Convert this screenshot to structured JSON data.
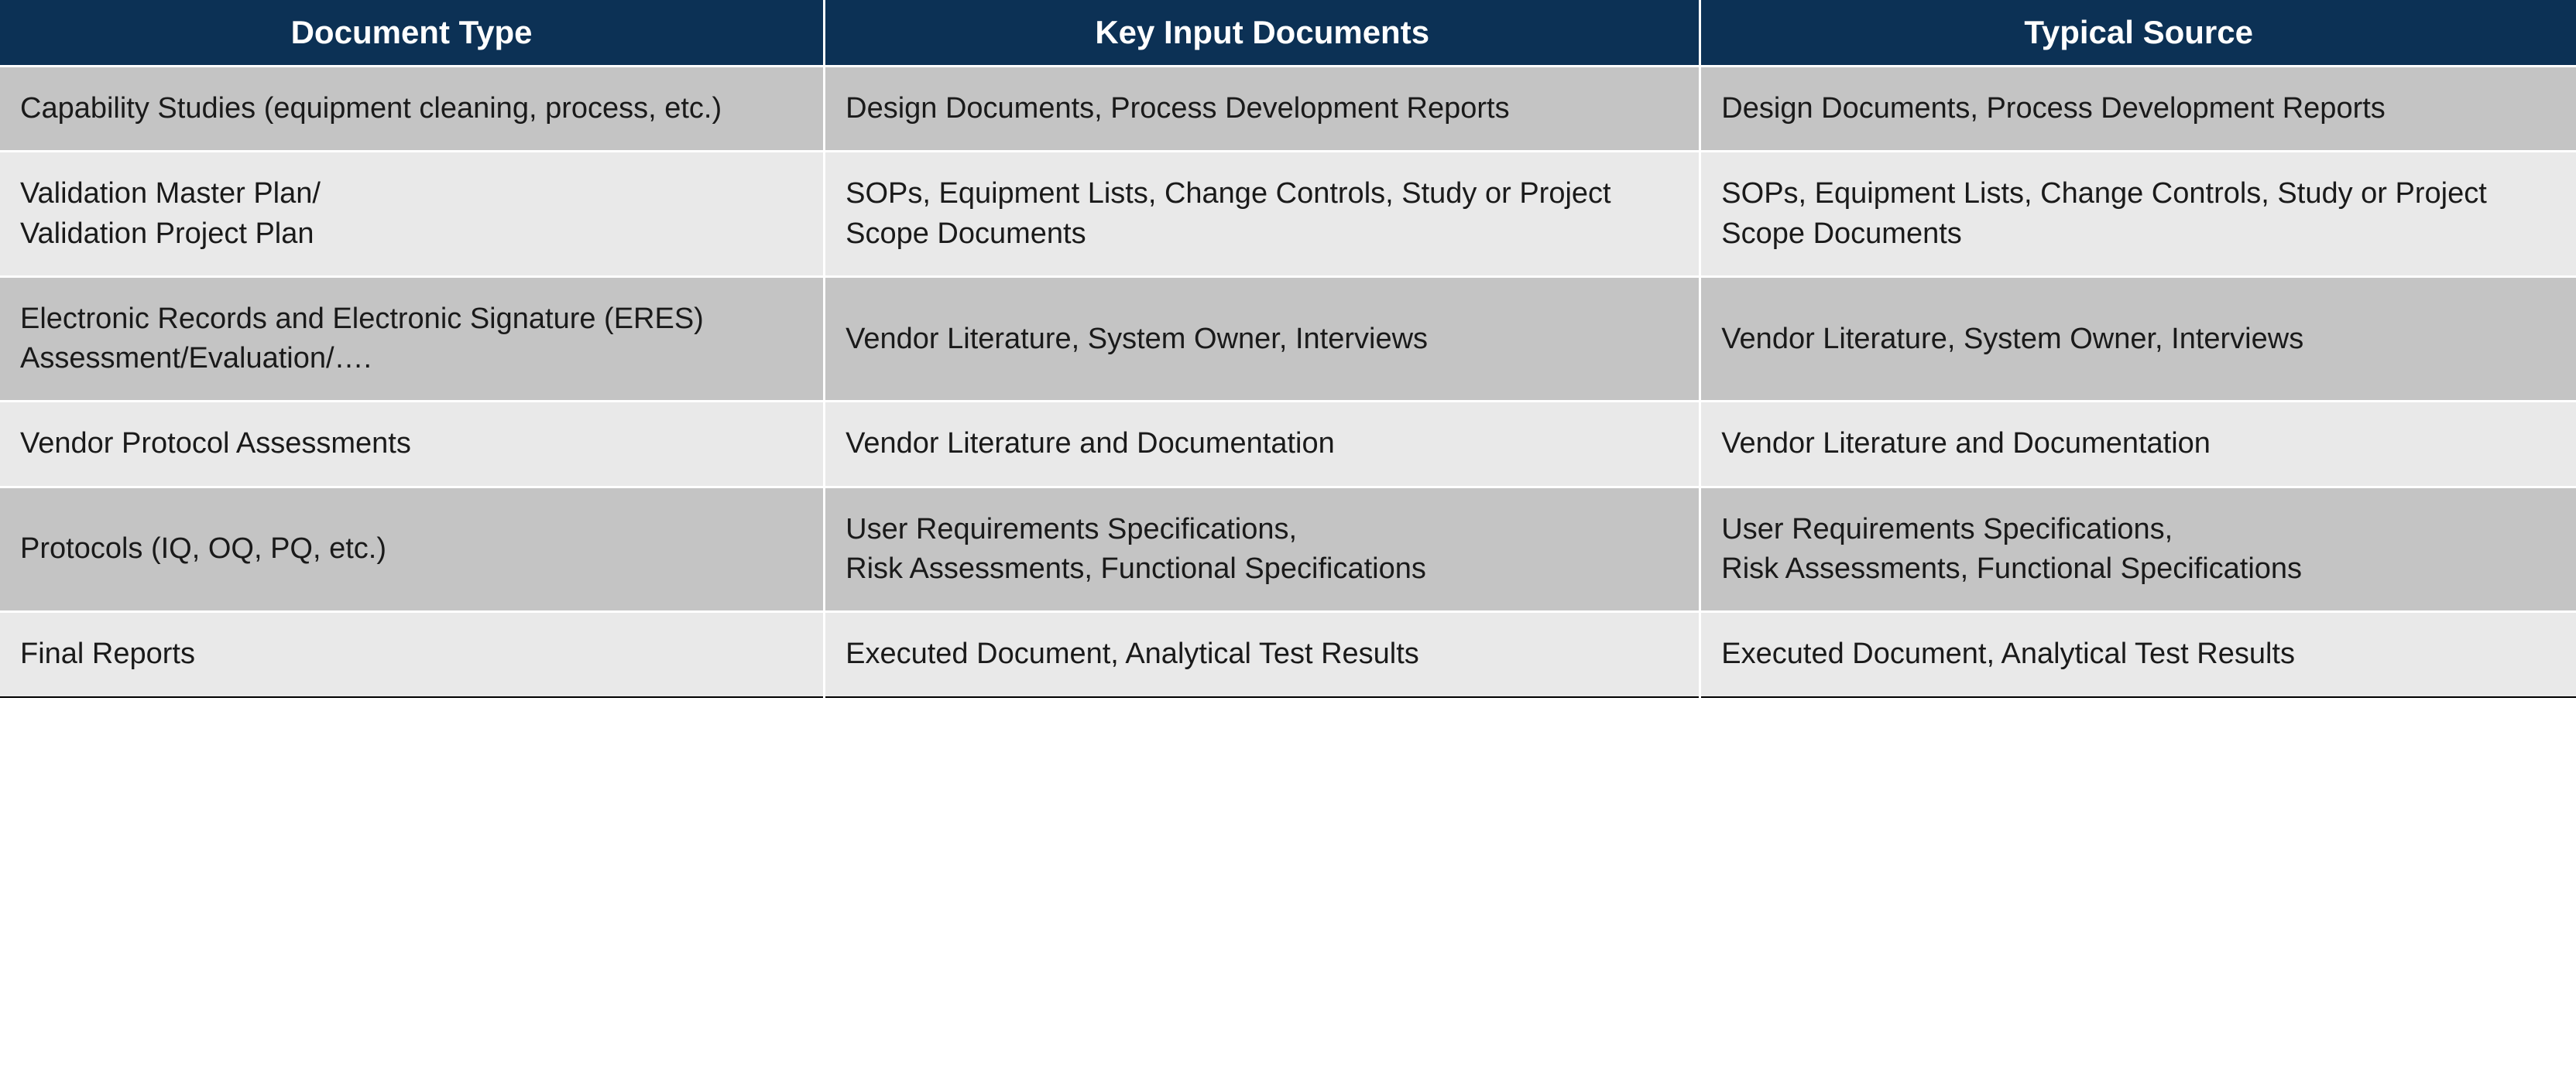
{
  "table": {
    "headers": [
      "Document Type",
      "Key Input Documents",
      "Typical Source"
    ],
    "rows": [
      {
        "doc_type": "Capability Studies (equipment cleaning, process, etc.)",
        "key_input": "Design Documents, Process Development Reports",
        "source": "Design Documents, Process Development Reports"
      },
      {
        "doc_type": "Validation Master Plan/\nValidation Project Plan",
        "key_input": "SOPs, Equipment Lists, Change Controls, Study or Project Scope Documents",
        "source": "SOPs, Equipment Lists, Change Controls, Study or Project Scope Documents"
      },
      {
        "doc_type": "Electronic Records and Electronic Signature (ERES) Assessment/Evaluation/….",
        "key_input": "Vendor Literature, System Owner, Interviews",
        "source": "Vendor Literature, System Owner, Interviews"
      },
      {
        "doc_type": "Vendor Protocol Assessments",
        "key_input": "Vendor Literature and Documentation",
        "source": "Vendor Literature and Documentation"
      },
      {
        "doc_type": "Protocols (IQ, OQ, PQ, etc.)",
        "key_input": "User Requirements Specifications,\nRisk Assessments, Functional Specifications",
        "source": "User Requirements Specifications,\nRisk Assessments, Functional Specifications"
      },
      {
        "doc_type": "Final Reports",
        "key_input": "Executed Document, Analytical Test Results",
        "source": "Executed Document, Analytical Test Results"
      }
    ]
  },
  "chart_data": {
    "type": "table",
    "headers": [
      "Document Type",
      "Key Input Documents",
      "Typical Source"
    ],
    "rows": [
      [
        "Capability Studies (equipment cleaning, process, etc.)",
        "Design Documents, Process Development Reports",
        "Design Documents, Process Development Reports"
      ],
      [
        "Validation Master Plan/ Validation Project Plan",
        "SOPs, Equipment Lists, Change Controls, Study or Project Scope Documents",
        "SOPs, Equipment Lists, Change Controls, Study or Project Scope Documents"
      ],
      [
        "Electronic Records and Electronic Signature (ERES) Assessment/Evaluation/….",
        "Vendor Literature, System Owner, Interviews",
        "Vendor Literature, System Owner, Interviews"
      ],
      [
        "Vendor Protocol Assessments",
        "Vendor Literature and Documentation",
        "Vendor Literature and Documentation"
      ],
      [
        "Protocols (IQ, OQ, PQ, etc.)",
        "User Requirements Specifications, Risk Assessments, Functional Specifications",
        "User Requirements Specifications, Risk Assessments, Functional Specifications"
      ],
      [
        "Final Reports",
        "Executed Document, Analytical Test Results",
        "Executed Document, Analytical Test Results"
      ]
    ]
  }
}
